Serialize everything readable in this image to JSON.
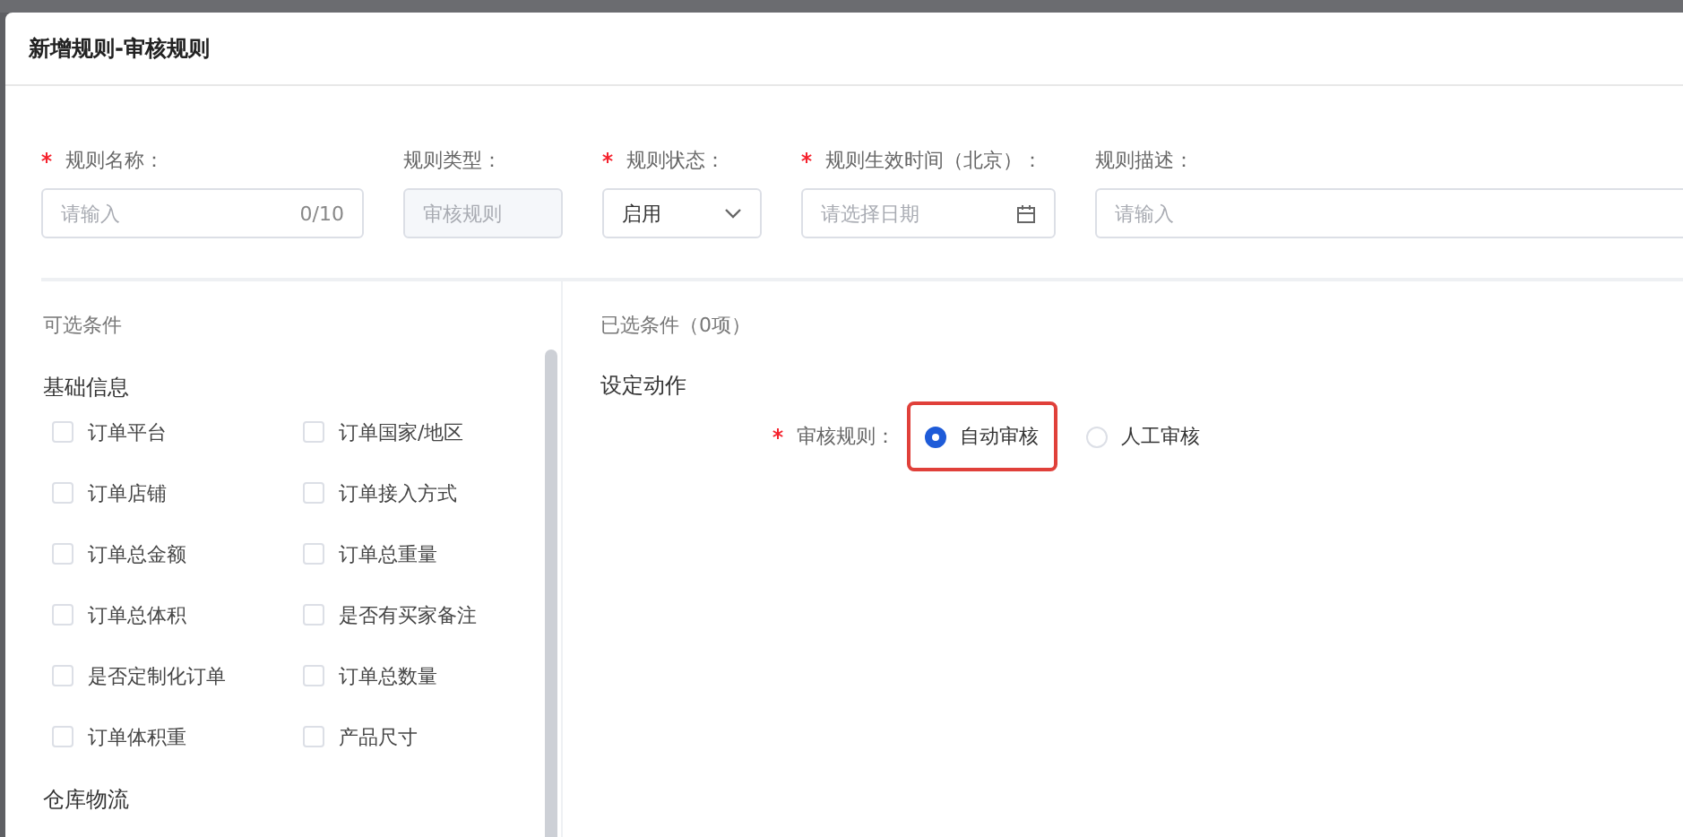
{
  "header": {
    "title": "新增规则-审核规则"
  },
  "form_fields": [
    {
      "label": "规则名称：",
      "required": true,
      "kind": "text",
      "placeholder": "请输入",
      "counter": "0/10"
    },
    {
      "label": "规则类型：",
      "required": false,
      "kind": "readonly",
      "value": "审核规则"
    },
    {
      "label": "规则状态：",
      "required": true,
      "kind": "select",
      "value": "启用"
    },
    {
      "label": "规则生效时间（北京）：",
      "required": true,
      "kind": "date",
      "placeholder": "请选择日期"
    },
    {
      "label": "规则描述：",
      "required": false,
      "kind": "text",
      "placeholder": "请输入"
    }
  ],
  "available_conditions": {
    "title": "可选条件",
    "groups": [
      {
        "name": "基础信息",
        "items": [
          {
            "label": "订单平台",
            "checked": false
          },
          {
            "label": "订单国家/地区",
            "checked": false
          },
          {
            "label": "订单店铺",
            "checked": false
          },
          {
            "label": "订单接入方式",
            "checked": false
          },
          {
            "label": "订单总金额",
            "checked": false
          },
          {
            "label": "订单总重量",
            "checked": false
          },
          {
            "label": "订单总体积",
            "checked": false
          },
          {
            "label": "是否有买家备注",
            "checked": false
          },
          {
            "label": "是否定制化订单",
            "checked": false
          },
          {
            "label": "订单总数量",
            "checked": false
          },
          {
            "label": "订单体积重",
            "checked": false
          },
          {
            "label": "产品尺寸",
            "checked": false
          }
        ]
      },
      {
        "name": "仓库物流"
      }
    ]
  },
  "selected_conditions": {
    "title": "已选条件（0项）"
  },
  "action": {
    "title": "设定动作",
    "field": {
      "label": "审核规则：",
      "required": true,
      "options": [
        {
          "label": "自动审核",
          "selected": true,
          "highlighted": true
        },
        {
          "label": "人工审核",
          "selected": false,
          "highlighted": false
        }
      ]
    }
  }
}
